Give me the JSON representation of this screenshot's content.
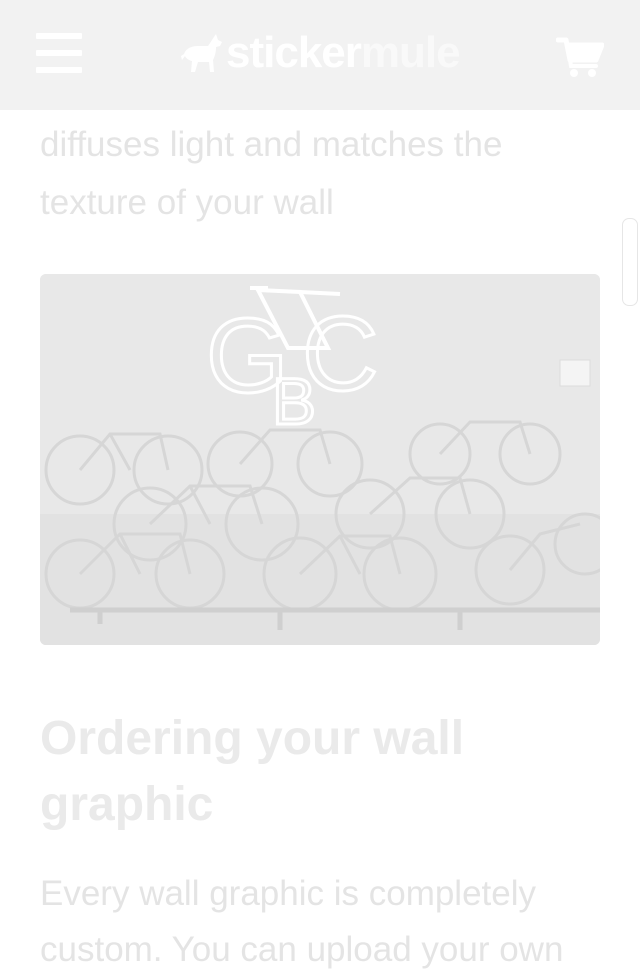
{
  "header": {
    "logo": {
      "part_a": "sticker",
      "part_b": "mule"
    },
    "icons": {
      "menu": "hamburger-menu-icon",
      "cart": "shopping-cart-icon",
      "logo": "mule-logo-icon"
    }
  },
  "article": {
    "intro_line_1": "diffuses light and matches the",
    "intro_line_2": "texture of your wall",
    "image": {
      "sign_letters": [
        "G",
        "B",
        "C"
      ]
    },
    "heading_line_1": "Ordering your wall",
    "heading_line_2": "graphic",
    "body_line_1": "Every wall graphic is completely",
    "body_line_2": "custom. You can upload your own"
  },
  "colors": {
    "header_bg": "#f2f2f2",
    "text": "#e4e4e4",
    "heading": "#eaeaea",
    "icon": "#ffffff"
  }
}
